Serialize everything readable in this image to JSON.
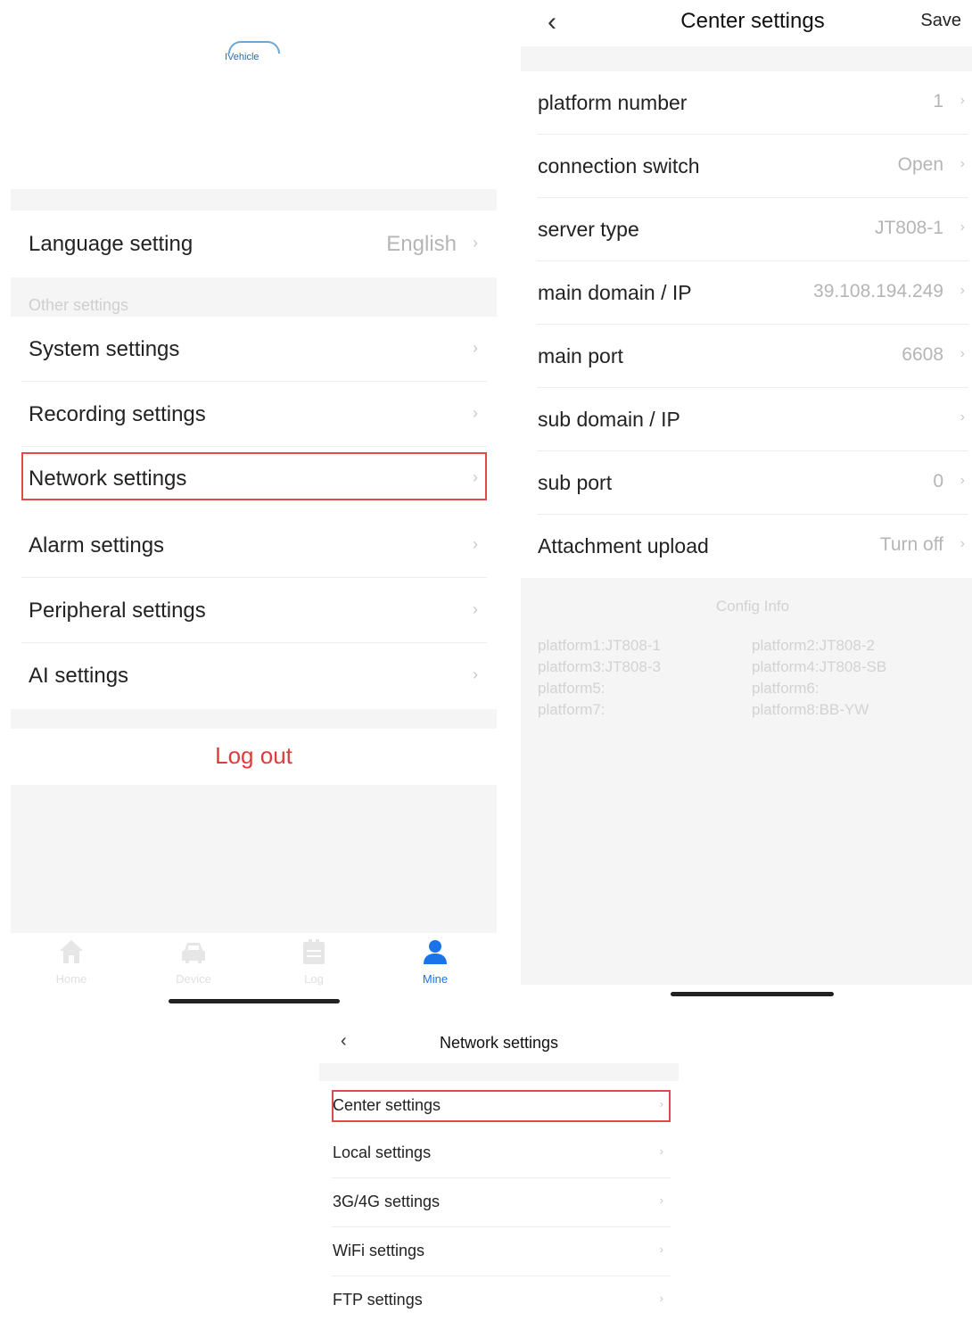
{
  "mine_screen": {
    "logo_text": "IVehicle",
    "language_row": {
      "label": "Language setting",
      "value": "English"
    },
    "other_settings_header": "Other settings",
    "items": [
      {
        "label": "System settings"
      },
      {
        "label": "Recording settings"
      },
      {
        "label": "Network settings"
      },
      {
        "label": "Alarm settings"
      },
      {
        "label": "Peripheral settings"
      },
      {
        "label": "AI settings"
      }
    ],
    "logout_label": "Log out",
    "tabs": [
      {
        "label": "Home",
        "icon": "home-icon"
      },
      {
        "label": "Device",
        "icon": "car-icon"
      },
      {
        "label": "Log",
        "icon": "log-icon"
      },
      {
        "label": "Mine",
        "icon": "user-icon"
      }
    ],
    "active_tab": "Mine",
    "active_color": "#1a73e8",
    "highlight_color": "#e04a4a",
    "logout_color": "#e03a3a"
  },
  "center_settings": {
    "back_icon": "chevron-left-icon",
    "title": "Center settings",
    "save_label": "Save",
    "rows": [
      {
        "label": "platform number",
        "value": "1"
      },
      {
        "label": "connection switch",
        "value": "Open"
      },
      {
        "label": "server type",
        "value": "JT808-1"
      },
      {
        "label": "main domain / IP",
        "value": "39.108.194.249"
      },
      {
        "label": "main port",
        "value": "6608"
      },
      {
        "label": "sub domain / IP",
        "value": ""
      },
      {
        "label": "sub port",
        "value": "0"
      },
      {
        "label": "Attachment upload",
        "value": "Turn off"
      }
    ],
    "config_title": "Config Info",
    "config_items": [
      "platform1:JT808-1",
      "platform2:JT808-2",
      "platform3:JT808-3",
      "platform4:JT808-SB",
      "platform5:",
      "platform6:",
      "platform7:",
      "platform8:BB-YW"
    ]
  },
  "network_settings": {
    "back_icon": "chevron-left-icon",
    "title": "Network settings",
    "items": [
      {
        "label": "Center settings"
      },
      {
        "label": "Local settings"
      },
      {
        "label": "3G/4G settings"
      },
      {
        "label": "WiFi settings"
      },
      {
        "label": "FTP settings"
      }
    ]
  }
}
